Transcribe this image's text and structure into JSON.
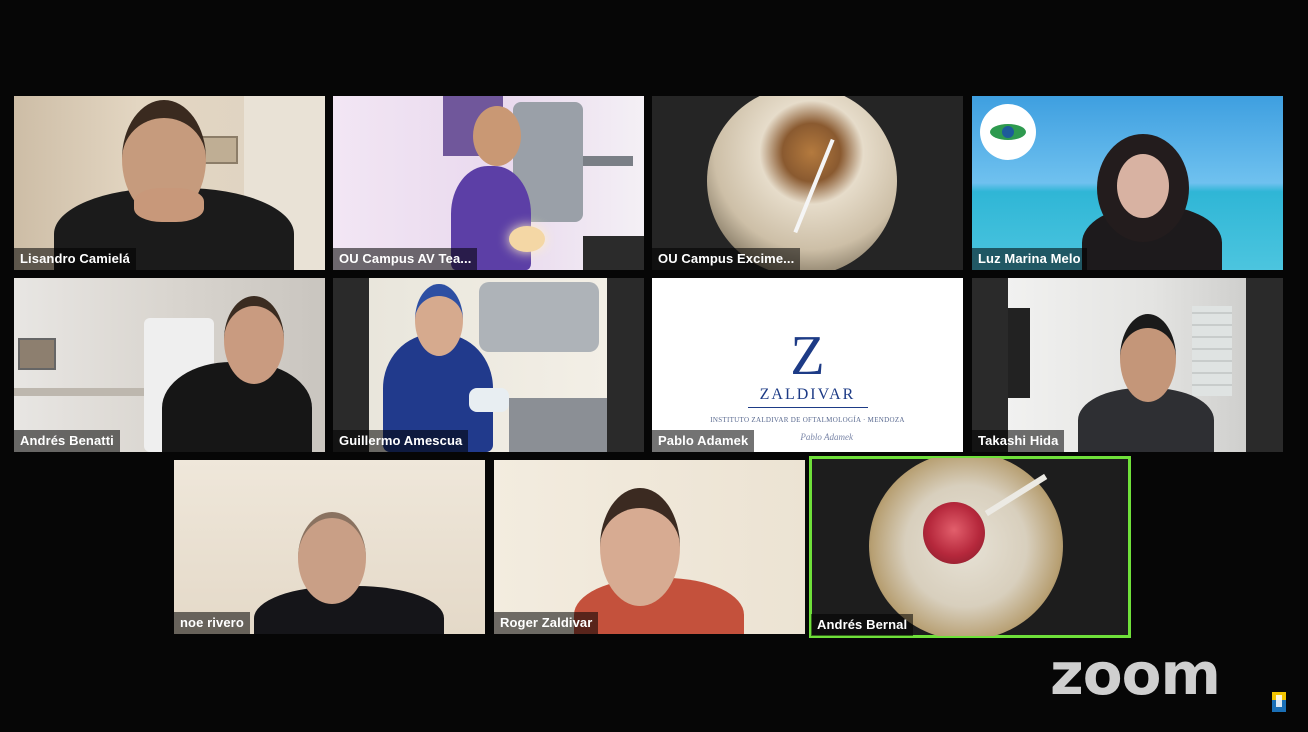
{
  "meeting": {
    "app_logo_text": "zoom",
    "active_speaker_color": "#6fe03a",
    "participants": [
      {
        "name": "Lisandro Camielá",
        "tile": "webcam"
      },
      {
        "name": "OU Campus AV Tea...",
        "tile": "surgery-room"
      },
      {
        "name": "OU Campus Excime...",
        "tile": "microscope-view"
      },
      {
        "name": "Luz Marina Melo",
        "tile": "webcam-beach-background"
      },
      {
        "name": "Andrés Benatti",
        "tile": "webcam"
      },
      {
        "name": "Guillermo Amescua",
        "tile": "surgery-room"
      },
      {
        "name": "Pablo Adamek",
        "tile": "logo-slide"
      },
      {
        "name": "Takashi Hida",
        "tile": "webcam"
      },
      {
        "name": "noe rivero",
        "tile": "webcam"
      },
      {
        "name": "Roger Zaldivar",
        "tile": "webcam"
      },
      {
        "name": "Andrés Bernal",
        "tile": "microscope-view",
        "active_speaker": true
      }
    ],
    "slide": {
      "letter": "Z",
      "wordmark": "ZALDIVAR",
      "tagline": "INSTITUTO ZALDIVAR DE OFTALMOLOGÍA · MENDOZA",
      "signature": "Pablo Adamek"
    }
  }
}
